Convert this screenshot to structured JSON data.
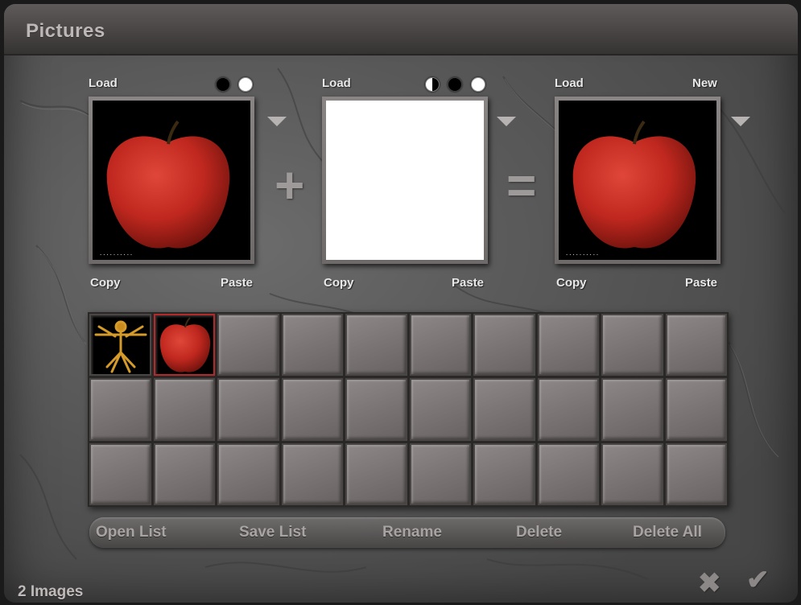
{
  "window": {
    "title": "Pictures"
  },
  "panels": [
    {
      "top_left": "Load",
      "top_right": "",
      "copy": "Copy",
      "paste": "Paste"
    },
    {
      "top_left": "Load",
      "top_right": "",
      "copy": "Copy",
      "paste": "Paste"
    },
    {
      "top_left": "Load",
      "top_right": "New",
      "copy": "Copy",
      "paste": "Paste"
    }
  ],
  "operators": {
    "plus": "+",
    "equals": "="
  },
  "buttons": {
    "open_list": "Open List",
    "save_list": "Save List",
    "rename": "Rename",
    "delete": "Delete",
    "delete_all": "Delete All"
  },
  "status": {
    "count_text": "2 Images"
  },
  "icons": {
    "cancel": "✖",
    "ok": "✔"
  },
  "colors": {
    "selection": "#b22a2a",
    "apple": "#c0281f"
  }
}
